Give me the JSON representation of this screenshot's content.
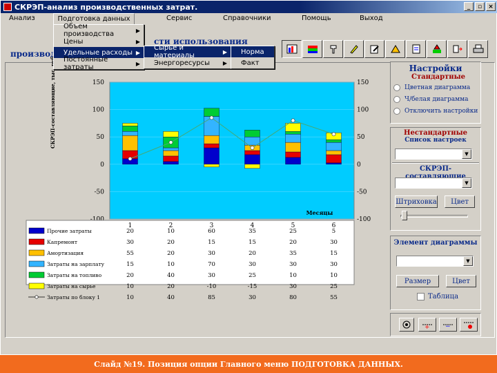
{
  "window": {
    "title": "СКРЭП-анализ производственных затрат."
  },
  "menu": [
    "Анализ",
    "Подготовка данных",
    "Сервис",
    "Справочники",
    "Помощь",
    "Выход"
  ],
  "dropdown1": [
    {
      "label": "Объем производства"
    },
    {
      "label": "Цены"
    },
    {
      "label": "Удельные расходы"
    },
    {
      "label": "Постоянные затраты"
    }
  ],
  "dropdown2": [
    {
      "label": "Сырье и материалы"
    },
    {
      "label": "Энергоресурсы"
    }
  ],
  "dropdown3": [
    {
      "label": "Норма"
    },
    {
      "label": "Факт"
    }
  ],
  "heading_left": "производс",
  "heading_right": "сти использования",
  "chart": {
    "ylabel": "СКРЭП-составляющие, тыс. руб.",
    "xlabel": "Месяцы",
    "yticks": [
      150,
      100,
      50,
      0,
      -50,
      -100
    ],
    "months": [
      "1",
      "2",
      "3",
      "4",
      "5",
      "6"
    ]
  },
  "chart_data": {
    "type": "bar",
    "categories": [
      "1",
      "2",
      "3",
      "4",
      "5",
      "6"
    ],
    "ylim": [
      -100,
      150
    ],
    "series": [
      {
        "name": "Прочие затраты",
        "color": "#0000cc",
        "values": [
          20,
          10,
          60,
          35,
          25,
          5
        ]
      },
      {
        "name": "Капремонт",
        "color": "#e60000",
        "values": [
          30,
          20,
          15,
          15,
          20,
          30
        ]
      },
      {
        "name": "Амортизация",
        "color": "#ffc000",
        "values": [
          55,
          20,
          30,
          20,
          35,
          15
        ]
      },
      {
        "name": "Затраты на зарплату",
        "color": "#33b4ff",
        "values": [
          15,
          10,
          70,
          30,
          30,
          30
        ]
      },
      {
        "name": "Затраты на топливо",
        "color": "#00cc33",
        "values": [
          20,
          40,
          30,
          25,
          10,
          10
        ]
      },
      {
        "name": "Затраты на сырье",
        "color": "#ffff00",
        "values": [
          10,
          20,
          -10,
          -15,
          30,
          25
        ]
      },
      {
        "name": "Затраты по блоку 1",
        "color": "#ffffff",
        "values": [
          10,
          40,
          85,
          30,
          80,
          55
        ]
      }
    ]
  },
  "panel": {
    "title": "Настройки",
    "standard": "Стандартные",
    "radios": [
      "Цветная диаграмма",
      "Ч/белая диаграмма",
      "Отключить настройки"
    ],
    "nonstandard": "Нестандартные",
    "settings_list": "Список настроек",
    "components": "СКРЭП-составляющие",
    "hatch": "Штриховка",
    "color": "Цвет",
    "element": "Элемент диаграммы",
    "size": "Размер",
    "color2": "Цвет",
    "table": "Таблица"
  },
  "caption": "Слайд №19. Позиция опции Главного меню ПОДГОТОВКА ДАННЫХ.",
  "colors": {
    "plot_bg": "#00ccff",
    "caption_bg": "#f26b1e"
  }
}
